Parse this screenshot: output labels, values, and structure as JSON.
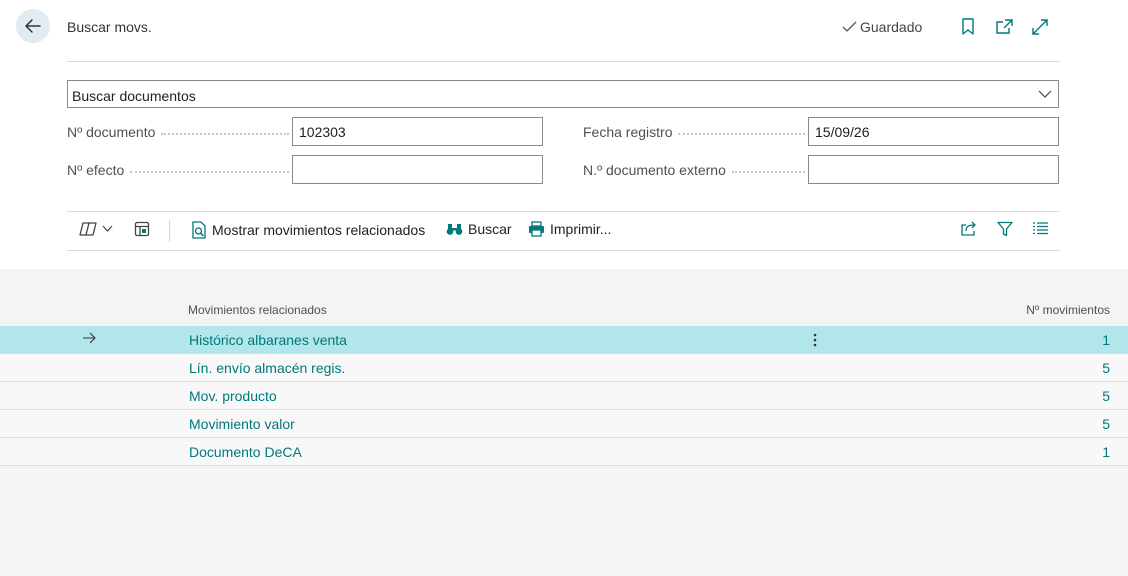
{
  "header": {
    "title": "Buscar movs.",
    "saved_label": "Guardado"
  },
  "search_select": {
    "value": "Buscar documentos"
  },
  "fields": {
    "doc_no": {
      "label": "Nº documento",
      "value": "102303"
    },
    "posting_date": {
      "label": "Fecha registro",
      "value": "15/09/26"
    },
    "bill_no": {
      "label": "Nº efecto",
      "value": ""
    },
    "ext_doc_no": {
      "label": "N.º documento externo",
      "value": ""
    }
  },
  "toolbar": {
    "show_related": "Mostrar movimientos relacionados",
    "find": "Buscar",
    "print": "Imprimir..."
  },
  "list": {
    "columns": {
      "name": "Movimientos relacionados",
      "count": "Nº movimientos"
    },
    "rows": [
      {
        "name": "Histórico albaranes venta",
        "count": "1"
      },
      {
        "name": "Lín. envío almacén regis.",
        "count": "5"
      },
      {
        "name": "Mov. producto",
        "count": "5"
      },
      {
        "name": "Movimiento valor",
        "count": "5"
      },
      {
        "name": "Documento DeCA",
        "count": "1"
      }
    ]
  },
  "colors": {
    "accent": "#00787c",
    "selected_row": "#b2e6ea",
    "list_bg": "#f4f4f4"
  }
}
